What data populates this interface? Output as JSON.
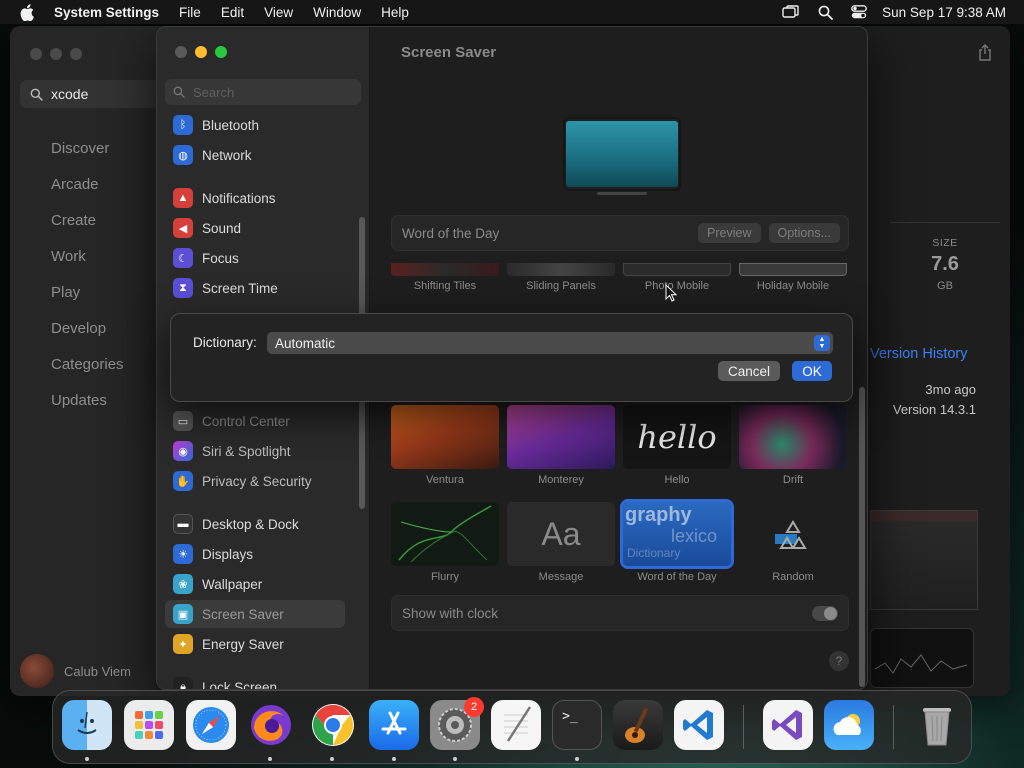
{
  "menubar": {
    "app_name": "System Settings",
    "menus": [
      "File",
      "Edit",
      "View",
      "Window",
      "Help"
    ],
    "clock": "Sun Sep 17  9:38 AM"
  },
  "appstore": {
    "search_value": "xcode",
    "nav": [
      "Discover",
      "Arcade",
      "Create",
      "Work",
      "Play",
      "Develop",
      "Categories",
      "Updates"
    ],
    "user_name": "Calub Viem",
    "size_label": "SIZE",
    "size_value": "7.6",
    "size_unit": "GB",
    "version_history": "Version History",
    "updated_ago": "3mo ago",
    "version": "Version 14.3.1"
  },
  "settings": {
    "search_placeholder": "Search",
    "sidebar": {
      "bluetooth": "Bluetooth",
      "network": "Network",
      "notifications": "Notifications",
      "sound": "Sound",
      "focus": "Focus",
      "screen_time": "Screen Time",
      "control_center": "Control Center",
      "siri": "Siri & Spotlight",
      "privacy": "Privacy & Security",
      "desktop_dock": "Desktop & Dock",
      "displays": "Displays",
      "wallpaper": "Wallpaper",
      "screen_saver": "Screen Saver",
      "energy_saver": "Energy Saver",
      "lock_screen": "Lock Screen"
    },
    "title": "Screen Saver",
    "current_saver": "Word of the Day",
    "preview_label": "Preview",
    "options_label": "Options...",
    "top_row_labels": [
      "Shifting Tiles",
      "Sliding Panels",
      "Photo Mobile",
      "Holiday Mobile"
    ],
    "grid_labels": [
      "Ventura",
      "Monterey",
      "Hello",
      "Drift",
      "Flurry",
      "Message",
      "Word of the Day",
      "Random"
    ],
    "hello_text": "hello",
    "message_text": "Aa",
    "wod_text": "graphy",
    "wod_text2": "lexico",
    "wod_text3": "Dictionary",
    "show_with_clock": "Show with clock",
    "help": "?"
  },
  "sheet": {
    "label": "Dictionary:",
    "value": "Automatic",
    "cancel": "Cancel",
    "ok": "OK"
  },
  "dock": {
    "settings_badge": "2",
    "terminal_prompt": ">_"
  },
  "colors": {
    "accent": "#2d6ad6",
    "link": "#3b82f6",
    "badge": "#ff3b30"
  }
}
